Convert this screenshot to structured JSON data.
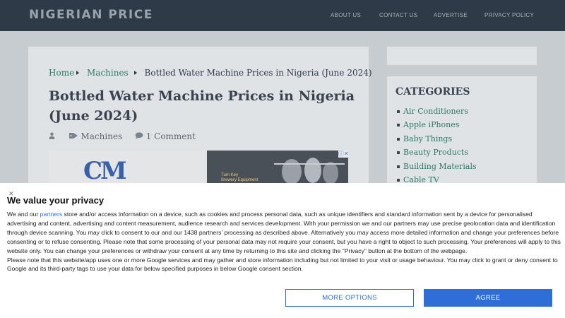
{
  "header": {
    "logo": "NIGERIAN PRICE",
    "nav": [
      "ABOUT US",
      "CONTACT US",
      "ADVERTISE",
      "PRIVACY POLICY"
    ]
  },
  "breadcrumb": {
    "home": "Home",
    "category": "Machines",
    "current": "Bottled Water Machine Prices in Nigeria (June 2024)"
  },
  "article": {
    "title": "Bottled Water Machine Prices in Nigeria (June 2024)",
    "category": "Machines",
    "comments": "1 Comment"
  },
  "thumb": {
    "logo": "CM"
  },
  "ad": {
    "text_line1": "Turn Key",
    "text_line2": "Brewery Equipment",
    "badge": "ⓘ✕"
  },
  "sidebar": {
    "heading": "CATEGORIES",
    "items": [
      "Air Conditioners",
      "Apple iPhones",
      "Baby Things",
      "Beauty Products",
      "Building Materials",
      "Cable TV"
    ]
  },
  "consent": {
    "close": "✕",
    "title": "We value your privacy",
    "p1_before": "We and our ",
    "p1_link": "partners",
    "p1_after": " store and/or access information on a device, such as cookies and process personal data, such as unique identifiers and standard information sent by a device for personalised advertising and content, advertising and content measurement, audience research and services development. With your permission we and our partners may use precise geolocation data and identification through device scanning. You may click to consent to our and our 1438 partners’ processing as described above. Alternatively you may access more detailed information and change your preferences before consenting or to refuse consenting. Please note that some processing of your personal data may not require your consent, but you have a right to object to such processing. Your preferences will apply to this website only. You can change your preferences or withdraw your consent at any time by returning to this site and clicking the \"Privacy\" button at the bottom of the webpage.",
    "p2": "Please note that this website/app uses one or more Google services and may gather and store information including but not limited to your visit or usage behaviour. You may click to grant or deny consent to Google and its third-party tags to use your data for below specified purposes in below Google consent section.",
    "more_options": "MORE OPTIONS",
    "agree": "AGREE"
  }
}
